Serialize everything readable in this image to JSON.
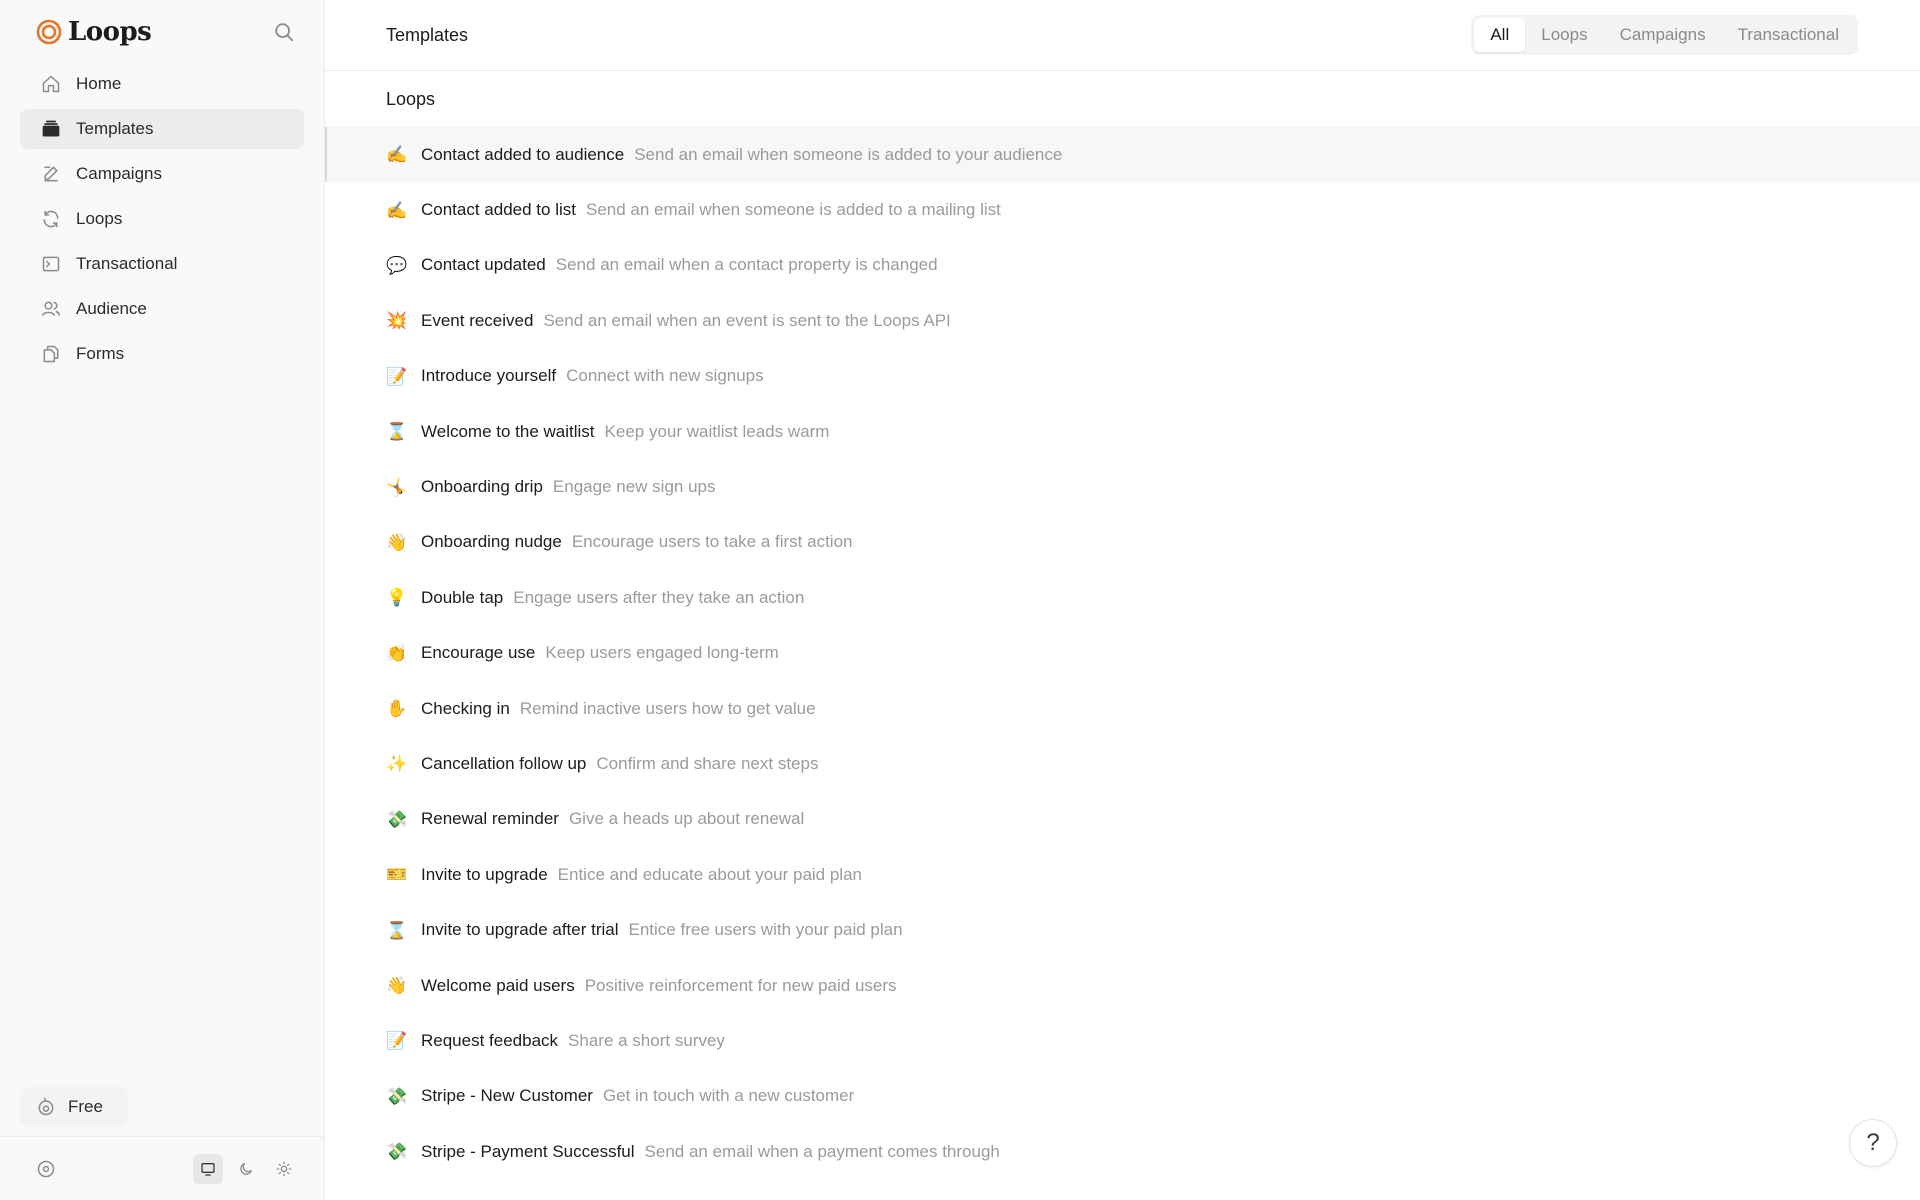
{
  "brand": {
    "name": "Loops",
    "accent": "#e8742a"
  },
  "sidebar": {
    "items": [
      {
        "label": "Home",
        "icon": "home-icon"
      },
      {
        "label": "Templates",
        "icon": "templates-icon"
      },
      {
        "label": "Campaigns",
        "icon": "pencil-icon"
      },
      {
        "label": "Loops",
        "icon": "refresh-icon"
      },
      {
        "label": "Transactional",
        "icon": "terminal-icon"
      },
      {
        "label": "Audience",
        "icon": "users-icon"
      },
      {
        "label": "Forms",
        "icon": "copy-icon"
      }
    ],
    "active_index": 1,
    "plan_label": "Free"
  },
  "header": {
    "title": "Templates",
    "tabs": [
      "All",
      "Loops",
      "Campaigns",
      "Transactional"
    ],
    "active_tab": "All"
  },
  "section": {
    "title": "Loops"
  },
  "templates": [
    {
      "emoji": "✍️",
      "name": "Contact added to audience",
      "desc": "Send an email when someone is added to your audience"
    },
    {
      "emoji": "✍️",
      "name": "Contact added to list",
      "desc": "Send an email when someone is added to a mailing list"
    },
    {
      "emoji": "💬",
      "name": "Contact updated",
      "desc": "Send an email when a contact property is changed"
    },
    {
      "emoji": "💥",
      "name": "Event received",
      "desc": "Send an email when an event is sent to the Loops API"
    },
    {
      "emoji": "📝",
      "name": "Introduce yourself",
      "desc": "Connect with new signups"
    },
    {
      "emoji": "⌛",
      "name": "Welcome to the waitlist",
      "desc": "Keep your waitlist leads warm"
    },
    {
      "emoji": "🤸",
      "name": "Onboarding drip",
      "desc": "Engage new sign ups"
    },
    {
      "emoji": "👋",
      "name": "Onboarding nudge",
      "desc": "Encourage users to take a first action"
    },
    {
      "emoji": "💡",
      "name": "Double tap",
      "desc": "Engage users after they take an action"
    },
    {
      "emoji": "👏",
      "name": "Encourage use",
      "desc": "Keep users engaged long-term"
    },
    {
      "emoji": "✋",
      "name": "Checking in",
      "desc": "Remind inactive users how to get value"
    },
    {
      "emoji": "✨",
      "name": "Cancellation follow up",
      "desc": "Confirm and share next steps"
    },
    {
      "emoji": "💸",
      "name": "Renewal reminder",
      "desc": "Give a heads up about renewal"
    },
    {
      "emoji": "🎫",
      "name": "Invite to upgrade",
      "desc": "Entice and educate about your paid plan"
    },
    {
      "emoji": "⌛",
      "name": "Invite to upgrade after trial",
      "desc": "Entice free users with your paid plan"
    },
    {
      "emoji": "👋",
      "name": "Welcome paid users",
      "desc": "Positive reinforcement for new paid users"
    },
    {
      "emoji": "📝",
      "name": "Request feedback",
      "desc": "Share a short survey"
    },
    {
      "emoji": "💸",
      "name": "Stripe - New Customer",
      "desc": "Get in touch with a new customer"
    },
    {
      "emoji": "💸",
      "name": "Stripe - Payment Successful",
      "desc": "Send an email when a payment comes through"
    }
  ],
  "help_label": "?"
}
